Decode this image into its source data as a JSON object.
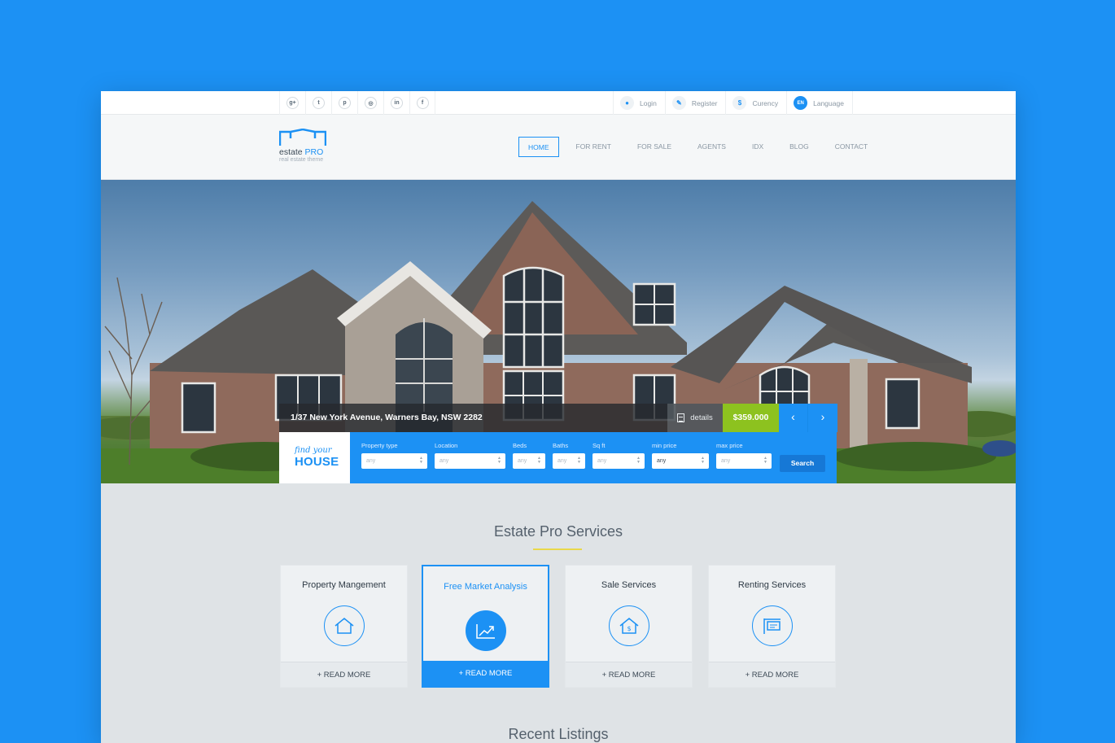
{
  "topbar": {
    "social": [
      {
        "name": "google-plus-icon",
        "glyph": "g+"
      },
      {
        "name": "twitter-icon",
        "glyph": "t"
      },
      {
        "name": "pinterest-icon",
        "glyph": "p"
      },
      {
        "name": "dribbble-icon",
        "glyph": "◎"
      },
      {
        "name": "linkedin-icon",
        "glyph": "in"
      },
      {
        "name": "facebook-icon",
        "glyph": "f"
      }
    ],
    "login": "Login",
    "register": "Register",
    "currency": "Curency",
    "language_code": "EN",
    "language": "Language"
  },
  "header": {
    "logo_name": "estate",
    "logo_pro": "PRO",
    "logo_tagline": "real estate theme",
    "nav": [
      "HOME",
      "FOR RENT",
      "FOR SALE",
      "AGENTS",
      "IDX",
      "BLOG",
      "CONTACT"
    ]
  },
  "hero": {
    "address": "1/37 New York Avenue, Warners Bay, NSW 2282",
    "details_label": "details",
    "price": "$359.000",
    "prev": "‹",
    "next": "›"
  },
  "search": {
    "find_line1": "find your",
    "find_line2": "HOUSE",
    "fields": [
      {
        "label": "Property type",
        "value": "any"
      },
      {
        "label": "Location",
        "value": "any"
      },
      {
        "label": "Beds",
        "value": "any"
      },
      {
        "label": "Baths",
        "value": "any"
      },
      {
        "label": "Sq ft",
        "value": "any"
      },
      {
        "label": "min price",
        "value": "any"
      },
      {
        "label": "max price",
        "value": "any"
      }
    ],
    "button": "Search"
  },
  "services": {
    "title": "Estate Pro Services",
    "cards": [
      {
        "title": "Property Mangement",
        "icon": "house-icon",
        "more": "+ READ MORE"
      },
      {
        "title": "Free Market Analysis",
        "icon": "chart-icon",
        "more": "+ READ MORE"
      },
      {
        "title": "Sale Services",
        "icon": "house-dollar-icon",
        "more": "+ READ MORE"
      },
      {
        "title": "Renting Services",
        "icon": "rent-sign-icon",
        "more": "+ READ MORE"
      }
    ]
  },
  "recent": {
    "title": "Recent Listings"
  },
  "colors": {
    "background": "#1c91f4",
    "accent": "#1c91f4",
    "price": "#8dc21f",
    "underline": "#e9d84a"
  }
}
